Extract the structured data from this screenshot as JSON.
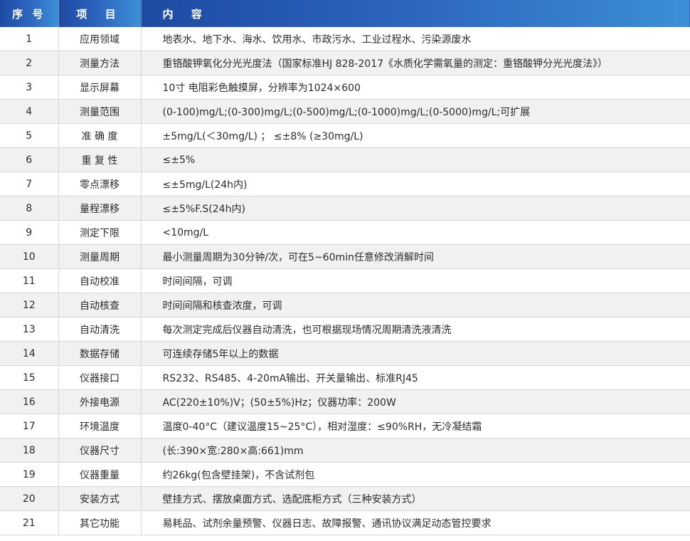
{
  "header": {
    "no": "序 号",
    "item": "项 目",
    "content": "内 容"
  },
  "rows": [
    {
      "no": "1",
      "item": "应用领域",
      "content": "地表水、地下水、海水、饮用水、市政污水、工业过程水、污染源废水"
    },
    {
      "no": "2",
      "item": "测量方法",
      "content": "重铬酸钾氧化分光光度法（国家标准HJ 828-2017《水质化学需氧量的测定：重铬酸钾分光光度法》）"
    },
    {
      "no": "3",
      "item": "显示屏幕",
      "content": "10寸 电阻彩色触摸屏，分辨率为1024×600"
    },
    {
      "no": "4",
      "item": "测量范围",
      "content": "(0-100)mg/L;(0-300)mg/L;(0-500)mg/L;(0-1000)mg/L;(0-5000)mg/L;可扩展"
    },
    {
      "no": "5",
      "item": "准 确 度",
      "content": "±5mg/L(＜30mg/L) ； ≤±8% (≥30mg/L)"
    },
    {
      "no": "6",
      "item": "重 复 性",
      "content": "≤±5%"
    },
    {
      "no": "7",
      "item": "零点漂移",
      "content": "≤±5mg/L(24h内)"
    },
    {
      "no": "8",
      "item": "量程漂移",
      "content": "≤±5%F.S(24h内)"
    },
    {
      "no": "9",
      "item": "测定下限",
      "content": "<10mg/L"
    },
    {
      "no": "10",
      "item": "测量周期",
      "content": "最小测量周期为30分钟/次，可在5~60min任意修改消解时间"
    },
    {
      "no": "11",
      "item": "自动校准",
      "content": "时间间隔，可调"
    },
    {
      "no": "12",
      "item": "自动核查",
      "content": "时间间隔和核查浓度，可调"
    },
    {
      "no": "13",
      "item": "自动清洗",
      "content": "每次测定完成后仪器自动清洗，也可根据现场情况周期清洗液清洗"
    },
    {
      "no": "14",
      "item": "数据存储",
      "content": "可连续存储5年以上的数据"
    },
    {
      "no": "15",
      "item": "仪器接口",
      "content": "RS232、RS485、4-20mA输出、开关量输出、标准RJ45"
    },
    {
      "no": "16",
      "item": "外接电源",
      "content": "AC(220±10%)V；(50±5%)Hz；仪器功率：200W"
    },
    {
      "no": "17",
      "item": "环境温度",
      "content": "温度0-40°C（建议温度15~25°C），相对湿度：≤90%RH，无冷凝结霜"
    },
    {
      "no": "18",
      "item": "仪器尺寸",
      "content": "(长:390×宽:280×高:661)mm"
    },
    {
      "no": "19",
      "item": "仪器重量",
      "content": "约26kg(包含壁挂架)，不含试剂包"
    },
    {
      "no": "20",
      "item": "安装方式",
      "content": "壁挂方式、摆放桌面方式、选配底柜方式（三种安装方式）"
    },
    {
      "no": "21",
      "item": "其它功能",
      "content": "易耗品、试剂余量预警、仪器日志、故障报警、通讯协议满足动态管控要求"
    }
  ]
}
